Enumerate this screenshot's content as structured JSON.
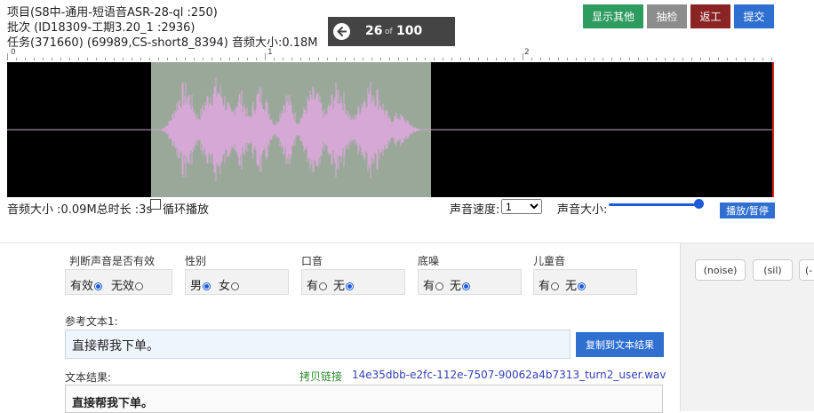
{
  "header": {
    "project": "项目(S8中-通用-短语音ASR-28-ql :250)",
    "batch": "批次 (ID18309-工期3.20_1 :2936)",
    "task": "任务(371660) (69989,CS-short8_8394) 音频大小:0.18M"
  },
  "navigator": {
    "current": "26",
    "of": "of",
    "total": "100"
  },
  "top_buttons": {
    "show_other": "显示其他",
    "spot_check": "抽检",
    "rework": "返工",
    "submit": "提交"
  },
  "colors": {
    "show_other": "#2e9b5f",
    "spot_check": "#8c8c8c",
    "rework": "#8b2525",
    "submit": "#2f6fd0"
  },
  "waveform": {
    "ruler_labels": [
      "0",
      "1",
      "2"
    ]
  },
  "player": {
    "info": "音频大小 :0.09M总时长 :3s",
    "loop_label": "循环播放",
    "speed_label": "声音速度:",
    "speed_value": "1",
    "volume_label": "声音大小:",
    "play_pause": "播放/暂停"
  },
  "attributes": [
    {
      "label": "判断声音是否有效",
      "options": [
        {
          "text": "有效",
          "checked": true
        },
        {
          "text": "无效",
          "checked": false
        }
      ]
    },
    {
      "label": "性别",
      "options": [
        {
          "text": "男",
          "checked": true
        },
        {
          "text": "女",
          "checked": false
        }
      ]
    },
    {
      "label": "口音",
      "options": [
        {
          "text": "有",
          "checked": false
        },
        {
          "text": "无",
          "checked": true
        }
      ]
    },
    {
      "label": "底噪",
      "options": [
        {
          "text": "有",
          "checked": false
        },
        {
          "text": "无",
          "checked": true
        }
      ]
    },
    {
      "label": "儿童音",
      "options": [
        {
          "text": "有",
          "checked": false
        },
        {
          "text": "无",
          "checked": true
        }
      ]
    }
  ],
  "reference": {
    "label": "参考文本1:",
    "text": "直接帮我下单。",
    "copy_button": "复制到文本结果"
  },
  "result": {
    "label": "文本结果:",
    "copy_link": "拷贝链接",
    "file_name": "14e35dbb-e2fc-112e-7507-90062a4b7313_turn2_user.wav",
    "text": "直接帮我下单。"
  },
  "tags": [
    "(noise)",
    "(sil)",
    "(-"
  ]
}
